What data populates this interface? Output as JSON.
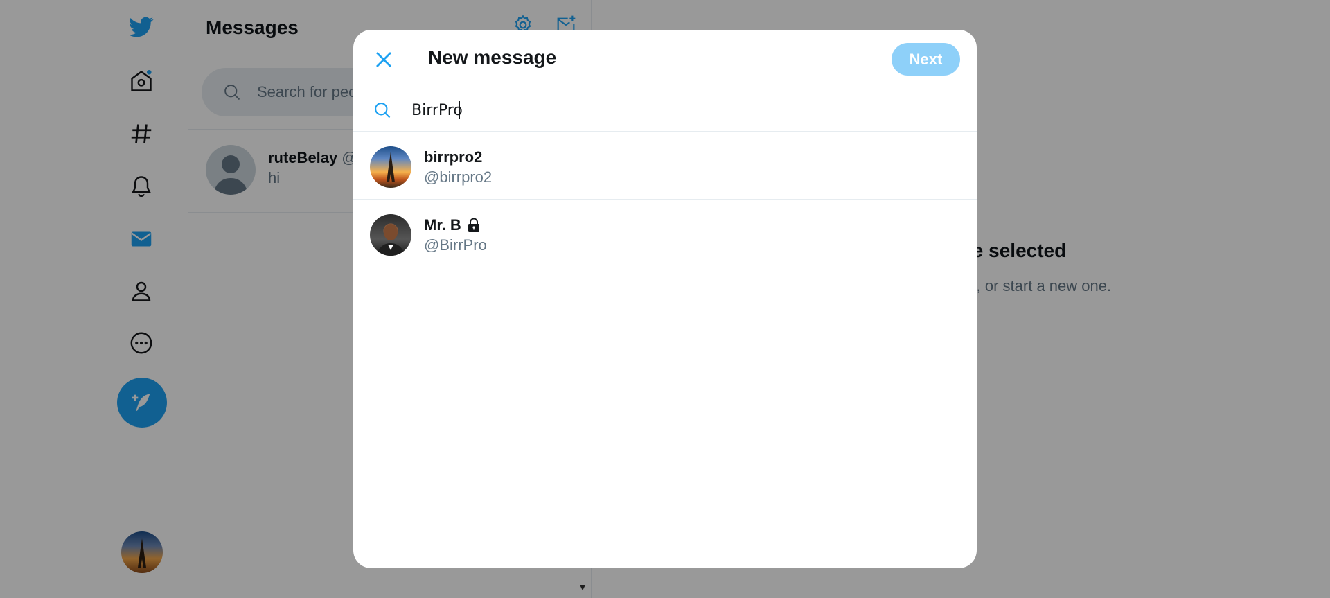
{
  "nav": {
    "items": [
      "twitter-logo",
      "home-icon",
      "explore-icon",
      "notifications-icon",
      "messages-icon",
      "profile-icon",
      "more-icon"
    ],
    "home_has_notification_dot": true,
    "accent_color": "#1da1f2"
  },
  "inbox": {
    "title": "Messages",
    "search_placeholder": "Search for people and groups",
    "conversations": [
      {
        "name": "ruteBelay",
        "handle": "@",
        "last_message": "hi"
      }
    ]
  },
  "detail": {
    "title": "You don’t have a message selected",
    "subtitle": "Choose one from your existing messages, or start a new one."
  },
  "modal": {
    "title": "New message",
    "next_label": "Next",
    "search_value": "BirrPro",
    "results": [
      {
        "name": "birrpro2",
        "handle": "@birrpro2",
        "protected": false
      },
      {
        "name": "Mr. B",
        "handle": "@BirrPro",
        "protected": true
      }
    ]
  }
}
